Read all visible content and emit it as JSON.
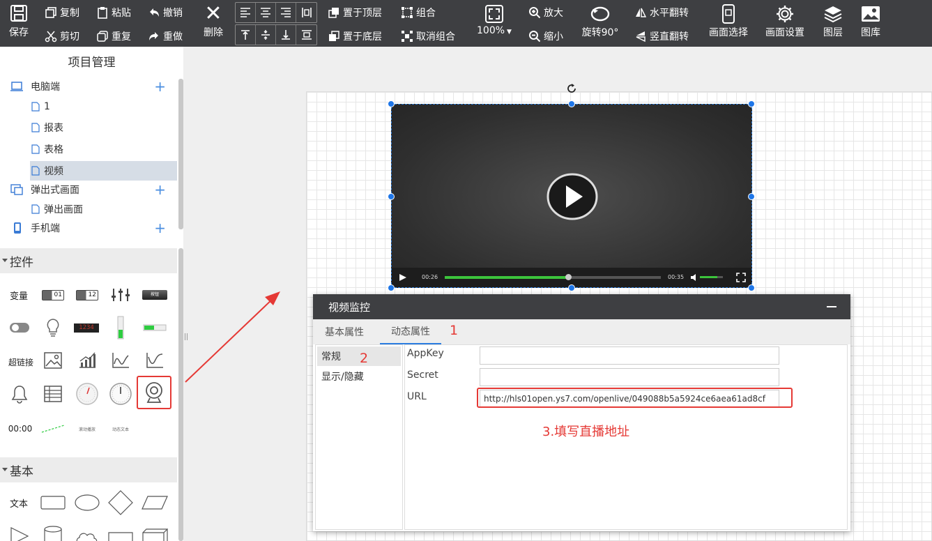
{
  "toolbar": {
    "save": "保存",
    "copy": "复制",
    "paste": "粘贴",
    "undo": "撤销",
    "cut": "剪切",
    "repeat": "重复",
    "redo": "重做",
    "delete": "删除",
    "bring_top": "置于顶层",
    "send_bottom": "置于底层",
    "group": "组合",
    "ungroup": "取消组合",
    "zoom": "100%",
    "zoom_in": "放大",
    "zoom_out": "缩小",
    "rotate": "旋转90°",
    "flip_h": "水平翻转",
    "flip_v": "竖直翻转",
    "screen_select": "画面选择",
    "screen_settings": "画面设置",
    "layers": "图层",
    "gallery": "图库"
  },
  "project": {
    "title": "项目管理",
    "tree": [
      {
        "label": "电脑端",
        "level": 0,
        "plus": true
      },
      {
        "label": "1",
        "level": 1
      },
      {
        "label": "报表",
        "level": 1
      },
      {
        "label": "表格",
        "level": 1
      },
      {
        "label": "视频",
        "level": 1,
        "selected": true
      },
      {
        "label": "弹出式画面",
        "level": 0,
        "plus": true
      },
      {
        "label": "弹出画面",
        "level": 1
      },
      {
        "label": "手机端",
        "level": 0,
        "plus": true
      }
    ]
  },
  "controls": {
    "title": "控件",
    "variable": "变量",
    "hyperlink": "超链接",
    "time": "00:00",
    "led_text": "1234",
    "button_text": "按钮",
    "scroll_text": "滚动播放",
    "dynamic_text": "动态文本",
    "display_01": "01",
    "display_12": "12"
  },
  "basic": {
    "title": "基本",
    "text": "文本"
  },
  "video": {
    "current_time": "00:26",
    "total_time": "00:35",
    "progress": 0.57,
    "volume": 0.75
  },
  "dialog": {
    "title": "视频监控",
    "tabs": [
      "基本属性",
      "动态属性"
    ],
    "active_tab": "动态属性",
    "side_items": [
      "常规",
      "显示/隐藏"
    ],
    "fields": {
      "appkey_label": "AppKey",
      "appkey_value": "",
      "secret_label": "Secret",
      "secret_value": "",
      "url_label": "URL",
      "url_value": "http://hls01open.ys7.com/openlive/049088b5a5924ce6aea61ad8cf"
    }
  },
  "annotations": {
    "one": "1",
    "two": "2",
    "three": "3.填写直播地址"
  },
  "colors": {
    "toolbar_bg": "#3e3f42",
    "accent": "#2b7de0",
    "annotation_red": "#e53935",
    "progress_green": "#3cc43c"
  }
}
